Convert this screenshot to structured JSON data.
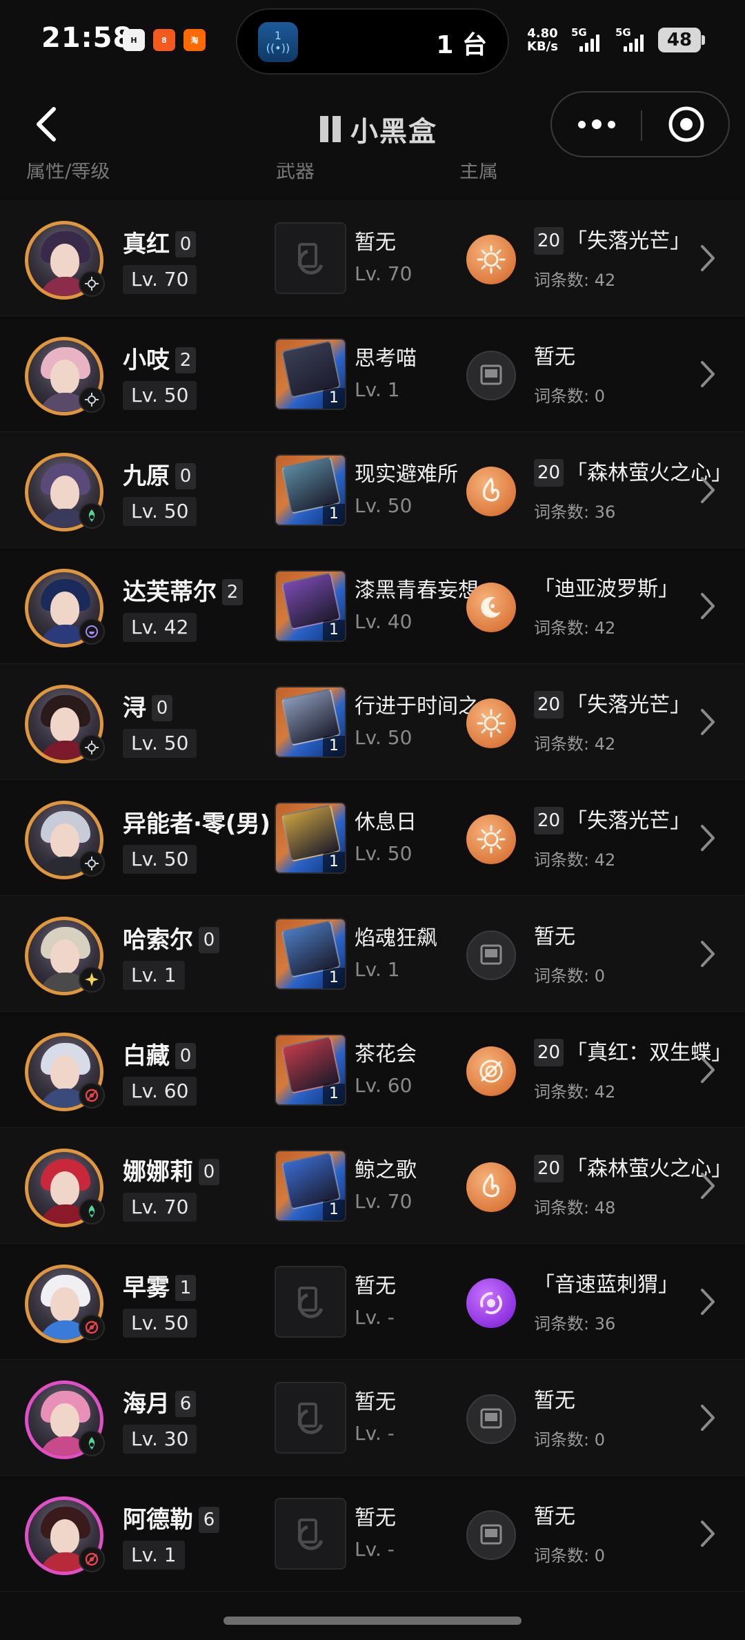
{
  "status_bar": {
    "time": "21:58",
    "island_badge": "1",
    "island_text": "1 台",
    "net_speed": "4.80",
    "net_unit": "KB/s",
    "sim1": "5G",
    "sim2": "5G",
    "battery": "48"
  },
  "nav": {
    "brand": "小黑盒",
    "back_icon": "chevron-left-icon",
    "more_icon": "more-dots-icon",
    "close_icon": "target-close-icon"
  },
  "headers": {
    "col1": "属性/等级",
    "col2": "武器",
    "col3": "主属"
  },
  "characters": [
    {
      "name": "真红",
      "eidolon": "0",
      "level": "Lv. 70",
      "path": "erudition",
      "avatar_border": "#e0963a",
      "hair": "#3a2a4a",
      "body": "#8a2c4a",
      "lc_name": "暂无",
      "lc_level": "Lv. 70",
      "lc_rank": "",
      "lc_colors": "",
      "relic_type": "orange",
      "relic_symbol": "sun",
      "relic_count": "20",
      "relic_name": "「失落光芒」",
      "relic_sub": "词条数: 42"
    },
    {
      "name": "小吱",
      "eidolon": "2",
      "level": "Lv. 50",
      "path": "erudition",
      "avatar_border": "#e0963a",
      "hair": "#e8b4c4",
      "body": "#5a4a6a",
      "lc_name": "思考喵",
      "lc_level": "Lv. 1",
      "lc_rank": "1",
      "lc_colors": "#3a3f55",
      "relic_type": "gray",
      "relic_symbol": "empty",
      "relic_count": "",
      "relic_name": "暂无",
      "relic_sub": "词条数: 0"
    },
    {
      "name": "九原",
      "eidolon": "0",
      "level": "Lv. 50",
      "path": "abundance",
      "avatar_border": "#e0963a",
      "hair": "#5a4a7a",
      "body": "#3a3a5a",
      "lc_name": "现实避难所",
      "lc_level": "Lv. 50",
      "lc_rank": "1",
      "lc_colors": "#5a8aa0",
      "relic_type": "orange",
      "relic_symbol": "flame",
      "relic_count": "20",
      "relic_name": "「森林萤火之心」",
      "relic_sub": "词条数: 36"
    },
    {
      "name": "达芙蒂尔",
      "eidolon": "2",
      "level": "Lv. 42",
      "path": "nihility",
      "avatar_border": "#e0963a",
      "hair": "#1a2a5a",
      "body": "#2a3a7a",
      "lc_name": "漆黑青春妄想",
      "lc_level": "Lv. 40",
      "lc_rank": "1",
      "lc_colors": "#7a4ab0",
      "relic_type": "orange",
      "relic_symbol": "moon",
      "relic_count": "",
      "relic_name": "「迪亚波罗斯」",
      "relic_sub": "词条数: 42"
    },
    {
      "name": "浔",
      "eidolon": "0",
      "level": "Lv. 50",
      "path": "erudition",
      "avatar_border": "#e0963a",
      "hair": "#2a1a1a",
      "body": "#7a1a2a",
      "lc_name": "行进于时间之外",
      "lc_level": "Lv. 50",
      "lc_rank": "1",
      "lc_colors": "#8a9ab8",
      "relic_type": "orange",
      "relic_symbol": "sun",
      "relic_count": "20",
      "relic_name": "「失落光芒」",
      "relic_sub": "词条数: 42"
    },
    {
      "name": "异能者·零(男)",
      "eidolon": "",
      "level": "Lv. 50",
      "path": "erudition",
      "avatar_border": "#e0963a",
      "hair": "#c8ccd8",
      "body": "#2a2a32",
      "lc_name": "休息日",
      "lc_level": "Lv. 50",
      "lc_rank": "1",
      "lc_colors": "#c8a040",
      "relic_type": "orange",
      "relic_symbol": "sun",
      "relic_count": "20",
      "relic_name": "「失落光芒」",
      "relic_sub": "词条数: 42"
    },
    {
      "name": "哈索尔",
      "eidolon": "0",
      "level": "Lv. 1",
      "path": "harmony",
      "avatar_border": "#e0963a",
      "hair": "#d8d0c0",
      "body": "#4a4a4a",
      "lc_name": "焰魂狂飙",
      "lc_level": "Lv. 1",
      "lc_rank": "1",
      "lc_colors": "#4a7ac0",
      "relic_type": "gray",
      "relic_symbol": "empty",
      "relic_count": "",
      "relic_name": "暂无",
      "relic_sub": "词条数: 0"
    },
    {
      "name": "白藏",
      "eidolon": "0",
      "level": "Lv. 60",
      "path": "destruction",
      "avatar_border": "#e0963a",
      "hair": "#d8dce8",
      "body": "#3a4a7a",
      "lc_name": "茶花会",
      "lc_level": "Lv. 60",
      "lc_rank": "1",
      "lc_colors": "#c03a4a",
      "relic_type": "orange",
      "relic_symbol": "target",
      "relic_count": "20",
      "relic_name": "「真红：双生蝶」",
      "relic_sub": "词条数: 42"
    },
    {
      "name": "娜娜莉",
      "eidolon": "0",
      "level": "Lv. 70",
      "path": "abundance",
      "avatar_border": "#e0963a",
      "hair": "#c8283a",
      "body": "#8a1a2a",
      "lc_name": "鲸之歌",
      "lc_level": "Lv. 70",
      "lc_rank": "1",
      "lc_colors": "#3a6ad0",
      "relic_type": "orange",
      "relic_symbol": "flame",
      "relic_count": "20",
      "relic_name": "「森林萤火之心」",
      "relic_sub": "词条数: 48"
    },
    {
      "name": "早雾",
      "eidolon": "1",
      "level": "Lv. 50",
      "path": "destruction",
      "avatar_border": "#e0963a",
      "hair": "#f0f0f4",
      "body": "#3a7ad8",
      "lc_name": "暂无",
      "lc_level": "Lv. -",
      "lc_rank": "",
      "lc_colors": "",
      "relic_type": "purple",
      "relic_symbol": "swirl",
      "relic_count": "",
      "relic_name": "「音速蓝刺猬」",
      "relic_sub": "词条数: 36"
    },
    {
      "name": "海月",
      "eidolon": "6",
      "level": "Lv. 30",
      "path": "abundance",
      "avatar_border": "#e04fc4",
      "hair": "#e890b8",
      "body": "#c84a8a",
      "lc_name": "暂无",
      "lc_level": "Lv. -",
      "lc_rank": "",
      "lc_colors": "",
      "relic_type": "gray",
      "relic_symbol": "empty",
      "relic_count": "",
      "relic_name": "暂无",
      "relic_sub": "词条数: 0"
    },
    {
      "name": "阿德勒",
      "eidolon": "6",
      "level": "Lv. 1",
      "path": "destruction",
      "avatar_border": "#e04fc4",
      "hair": "#3a1a1a",
      "body": "#b82a3a",
      "lc_name": "暂无",
      "lc_level": "Lv. -",
      "lc_rank": "",
      "lc_colors": "",
      "relic_type": "gray",
      "relic_symbol": "empty",
      "relic_count": "",
      "relic_name": "暂无",
      "relic_sub": "词条数: 0"
    }
  ]
}
